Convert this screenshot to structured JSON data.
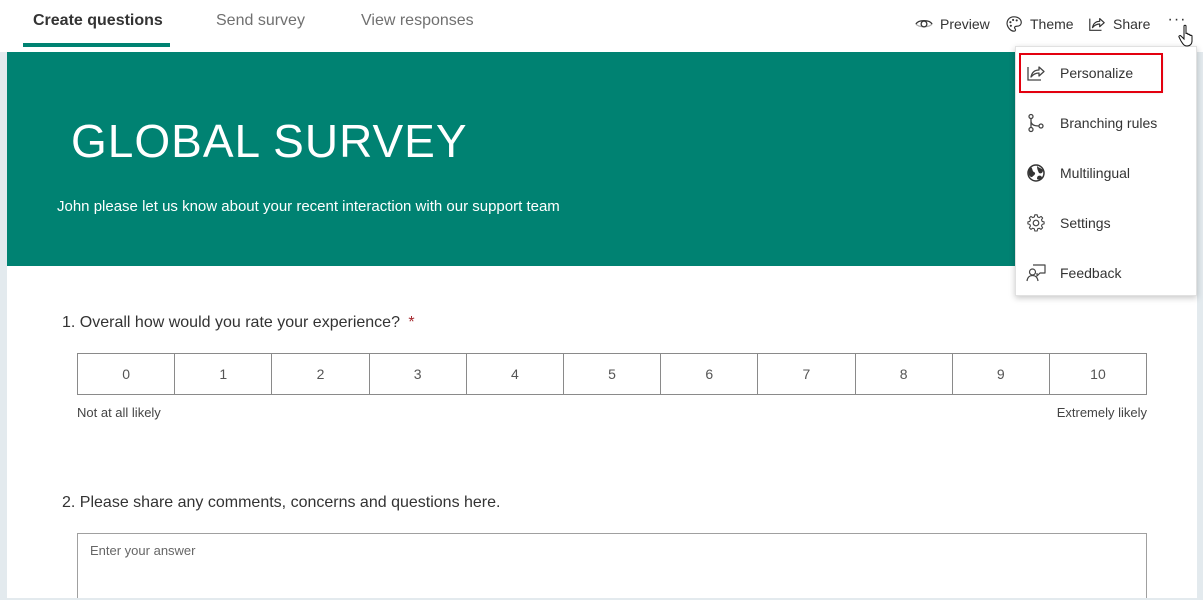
{
  "nav": {
    "tabs": [
      {
        "label": "Create questions",
        "active": true
      },
      {
        "label": "Send survey",
        "active": false
      },
      {
        "label": "View responses",
        "active": false
      }
    ],
    "toolbar": {
      "preview_label": "Preview",
      "theme_label": "Theme",
      "share_label": "Share",
      "more_label": "···"
    }
  },
  "banner": {
    "title": "GLOBAL SURVEY",
    "subtitle": "John please let us know about your recent interaction with our support team",
    "color": "#008272"
  },
  "questions": [
    {
      "number": "1.",
      "text": "Overall how would you rate your experience?",
      "required_mark": "*",
      "type": "net-promoter-score",
      "options": [
        "0",
        "1",
        "2",
        "3",
        "4",
        "5",
        "6",
        "7",
        "8",
        "9",
        "10"
      ],
      "low_label": "Not at all likely",
      "high_label": "Extremely likely"
    },
    {
      "number": "2.",
      "text": "Please share any comments, concerns and questions here.",
      "type": "text",
      "placeholder": "Enter your answer"
    }
  ],
  "menu": {
    "items": [
      {
        "label": "Personalize",
        "icon": "personalize-icon",
        "highlighted": true
      },
      {
        "label": "Branching rules",
        "icon": "branching-icon"
      },
      {
        "label": "Multilingual",
        "icon": "globe-icon"
      },
      {
        "label": "Settings",
        "icon": "gear-icon"
      },
      {
        "label": "Feedback",
        "icon": "feedback-icon"
      }
    ]
  },
  "colors": {
    "accent": "#008272",
    "highlight_outline": "#e3000f",
    "required": "#a4262c"
  }
}
